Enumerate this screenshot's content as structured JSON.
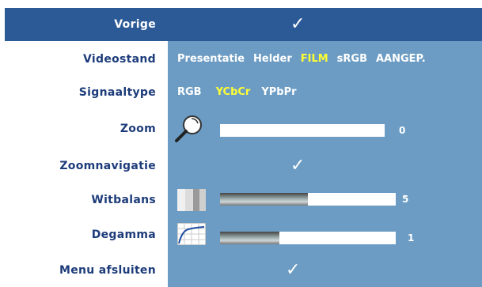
{
  "menu": {
    "back": {
      "label": "Vorige",
      "check": "✓"
    },
    "videomode": {
      "label": "Videostand",
      "options": [
        "Presentatie",
        "Helder",
        "FILM",
        "sRGB",
        "AANGEP."
      ],
      "active": "FILM"
    },
    "signaltype": {
      "label": "Signaaltype",
      "options": [
        "RGB",
        "YCbCr",
        "YPbPr"
      ],
      "active": "YCbCr"
    },
    "zoom": {
      "label": "Zoom",
      "value": "0",
      "level": 0,
      "icon": "magnifier-icon"
    },
    "zoomnav": {
      "label": "Zoomnavigatie",
      "check": "✓"
    },
    "whitebalance": {
      "label": "Witbalans",
      "value": "5",
      "level": 0.5,
      "icon": "white-balance-icon"
    },
    "degamma": {
      "label": "Degamma",
      "value": "1",
      "level": 0.34,
      "icon": "degamma-curve-icon"
    },
    "exit": {
      "label": "Menu afsluiten",
      "check": "✓"
    }
  },
  "colors": {
    "panel": "#6c9cc3",
    "highlight": "#2c5a97",
    "label": "#1d3c7a",
    "active_option": "#ffff33"
  }
}
